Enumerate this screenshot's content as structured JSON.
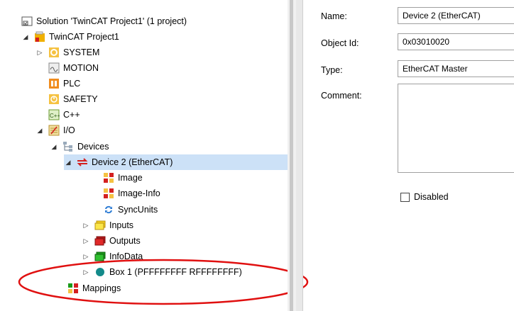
{
  "tree": {
    "solution": "Solution 'TwinCAT Project1' (1 project)",
    "project": "TwinCAT Project1",
    "system": "SYSTEM",
    "motion": "MOTION",
    "plc": "PLC",
    "safety": "SAFETY",
    "cpp": "C++",
    "io": "I/O",
    "devices": "Devices",
    "device2": "Device 2 (EtherCAT)",
    "image": "Image",
    "image_info": "Image-Info",
    "sync_units": "SyncUnits",
    "inputs": "Inputs",
    "outputs": "Outputs",
    "infodata": "InfoData",
    "box1": "Box 1 (PFFFFFFFF RFFFFFFFF)",
    "mappings": "Mappings"
  },
  "props": {
    "name_label": "Name:",
    "name_value": "Device 2 (EtherCAT)",
    "objid_label": "Object Id:",
    "objid_value": "0x03010020",
    "type_label": "Type:",
    "type_value": "EtherCAT Master",
    "comment_label": "Comment:",
    "disabled_label": "Disabled"
  },
  "colors": {
    "selection": "#cce1f7",
    "highlight": "#e01010"
  }
}
